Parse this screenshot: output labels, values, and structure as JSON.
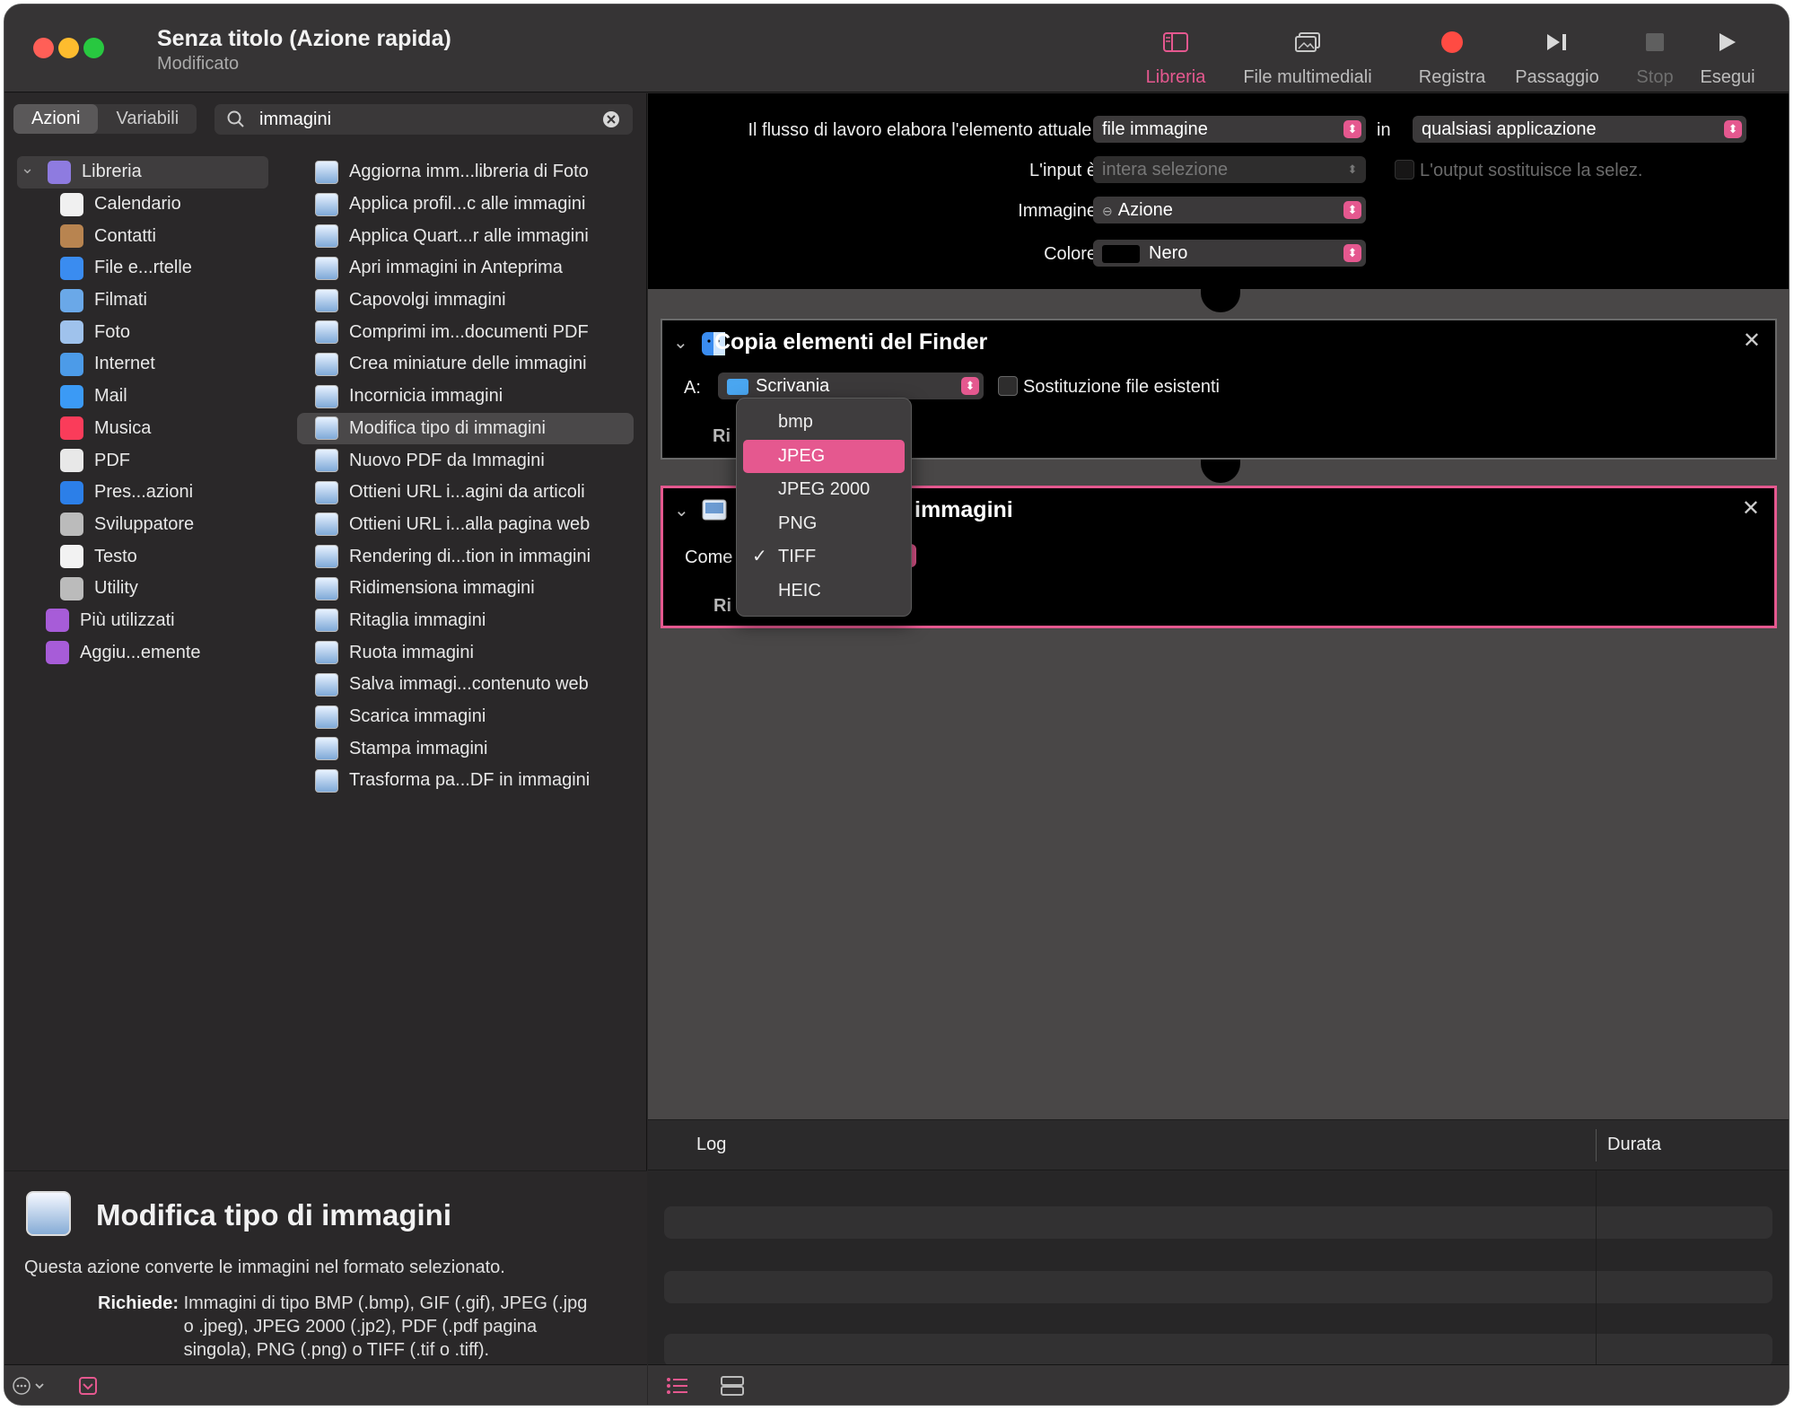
{
  "window": {
    "title": "Senza titolo (Azione rapida)",
    "subtitle": "Modificato"
  },
  "toolbar": [
    {
      "label": "Libreria",
      "icon": "sidebar-icon",
      "color": "#e5588f"
    },
    {
      "label": "File multimediali",
      "icon": "media-icon",
      "color": "#c8c8c8"
    },
    {
      "label": "Registra",
      "icon": "record-icon",
      "color": "#ff4b43"
    },
    {
      "label": "Passaggio",
      "icon": "step-icon",
      "color": "#d8d8d8"
    },
    {
      "label": "Stop",
      "icon": "stop-icon",
      "color": "#6f6f6f"
    },
    {
      "label": "Esegui",
      "icon": "play-icon",
      "color": "#d8d8d8"
    }
  ],
  "left": {
    "tabs": [
      "Azioni",
      "Variabili"
    ],
    "search": "immagini",
    "library": [
      {
        "label": "Libreria",
        "icon": "library-icon",
        "color": "#8e7be0"
      },
      {
        "label": "Calendario",
        "icon": "calendar-icon",
        "color": "#f0f0f0"
      },
      {
        "label": "Contatti",
        "icon": "contacts-icon",
        "color": "#b88450"
      },
      {
        "label": "File e...rtelle",
        "icon": "finder-icon",
        "color": "#3a8cf0"
      },
      {
        "label": "Filmati",
        "icon": "movies-icon",
        "color": "#6aa8e8"
      },
      {
        "label": "Foto",
        "icon": "photos-icon",
        "color": "#9fc2ec"
      },
      {
        "label": "Internet",
        "icon": "globe-icon",
        "color": "#4c9be8"
      },
      {
        "label": "Mail",
        "icon": "mail-icon",
        "color": "#3b9af5"
      },
      {
        "label": "Musica",
        "icon": "music-icon",
        "color": "#fa3c5a"
      },
      {
        "label": "PDF",
        "icon": "pdf-icon",
        "color": "#e8e8e8"
      },
      {
        "label": "Pres...azioni",
        "icon": "keynote-icon",
        "color": "#2c7fe8"
      },
      {
        "label": "Sviluppatore",
        "icon": "tools-icon",
        "color": "#bbbbbb"
      },
      {
        "label": "Testo",
        "icon": "text-icon",
        "color": "#f2f2f2"
      },
      {
        "label": "Utility",
        "icon": "utility-icon",
        "color": "#bbbbbb"
      },
      {
        "label": "Più utilizzati",
        "icon": "folder-icon",
        "color": "#a75cd8"
      },
      {
        "label": "Aggiu...emente",
        "icon": "folder-icon",
        "color": "#a75cd8"
      }
    ],
    "actions": [
      "Aggiorna imm...libreria di Foto",
      "Applica profil...c alle immagini",
      "Applica Quart...r alle immagini",
      "Apri immagini in Anteprima",
      "Capovolgi immagini",
      "Comprimi im...documenti PDF",
      "Crea miniature delle immagini",
      "Incornicia immagini",
      "Modifica tipo di immagini",
      "Nuovo PDF da Immagini",
      "Ottieni URL i...agini da articoli",
      "Ottieni URL i...alla pagina web",
      "Rendering di...tion in immagini",
      "Ridimensiona immagini",
      "Ritaglia immagini",
      "Ruota immagini",
      "Salva immagi...contenuto web",
      "Scarica immagini",
      "Stampa immagini",
      "Trasforma pa...DF in immagini"
    ],
    "selected_action": "Modifica tipo di immagini",
    "description": {
      "title": "Modifica tipo di immagini",
      "text": "Questa azione converte le immagini nel formato selezionato.",
      "req_label": "Richiede:",
      "req_text": "Immagini di tipo BMP (.bmp), GIF (.gif), JPEG (.jpg o .jpeg), JPEG 2000 (.jp2), PDF (.pdf pagina singola), PNG (.png) o TIFF (.tif o .tiff)."
    }
  },
  "workflow": {
    "receives_label": "Il flusso di lavoro elabora l'elemento attuale:",
    "receives_value": "file immagine",
    "in_label": "in",
    "app_value": "qualsiasi applicazione",
    "input_label": "L'input è",
    "input_value": "intera selezione",
    "output_label": "L'output sostituisce la selez.",
    "image_label": "Immagine",
    "image_value": "Azione",
    "color_label": "Colore",
    "color_value": "Nero"
  },
  "action1": {
    "title": "Copia elementi del Finder",
    "to_label": "A:",
    "to_value": "Scrivania",
    "replace_label": "Sostituzione file esistenti",
    "results_label": "Ri"
  },
  "action2": {
    "title_partial": "immagini",
    "as_label": "Come",
    "results_label": "Ri"
  },
  "dropdown": {
    "options": [
      "bmp",
      "JPEG",
      "JPEG 2000",
      "PNG",
      "TIFF",
      "HEIC"
    ],
    "highlighted": "JPEG",
    "checked": "TIFF"
  },
  "log": {
    "col1": "Log",
    "col2": "Durata"
  },
  "colors": {
    "accent": "#e5588f"
  }
}
